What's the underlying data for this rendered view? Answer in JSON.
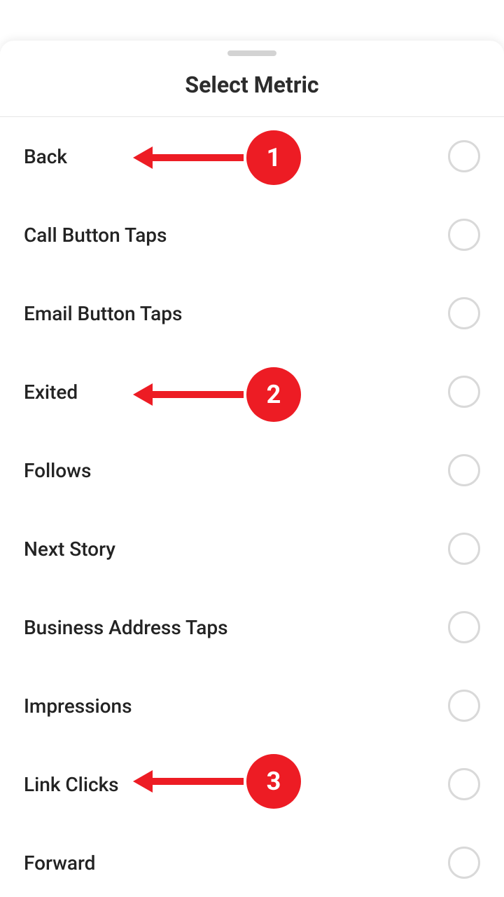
{
  "sheet": {
    "title": "Select Metric",
    "items": [
      {
        "label": "Back"
      },
      {
        "label": "Call Button Taps"
      },
      {
        "label": "Email Button Taps"
      },
      {
        "label": "Exited"
      },
      {
        "label": "Follows"
      },
      {
        "label": "Next Story"
      },
      {
        "label": "Business Address Taps"
      },
      {
        "label": "Impressions"
      },
      {
        "label": "Link Clicks"
      },
      {
        "label": "Forward"
      }
    ]
  },
  "annotations": {
    "0": "1",
    "1": "2",
    "2": "3"
  }
}
